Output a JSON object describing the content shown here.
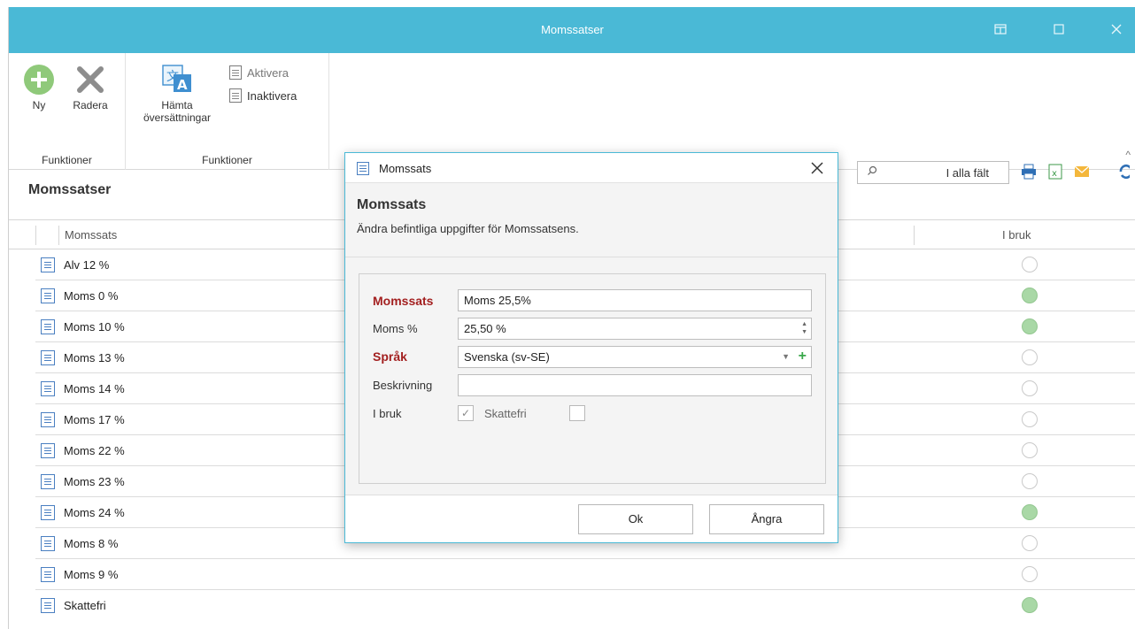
{
  "window": {
    "title": "Momssatser"
  },
  "ribbon": {
    "groups": [
      {
        "label": "Funktioner"
      },
      {
        "label": "Funktioner"
      }
    ],
    "new_label": "Ny",
    "delete_label": "Radera",
    "fetch_translations_label_1": "Hämta",
    "fetch_translations_label_2": "översättningar",
    "activate_label": "Aktivera",
    "deactivate_label": "Inaktivera"
  },
  "list": {
    "title": "Momssatser",
    "search_scope": "I alla fält",
    "columns": {
      "name": "Momssats",
      "in_use": "I bruk"
    },
    "rows": [
      {
        "label": "Alv 12 %",
        "in_use": false
      },
      {
        "label": "Moms 0 %",
        "in_use": true
      },
      {
        "label": "Moms 10 %",
        "in_use": true
      },
      {
        "label": "Moms 13 %",
        "in_use": false
      },
      {
        "label": "Moms 14 %",
        "in_use": false
      },
      {
        "label": "Moms 17 %",
        "in_use": false
      },
      {
        "label": "Moms 22 %",
        "in_use": false
      },
      {
        "label": "Moms 23 %",
        "in_use": false
      },
      {
        "label": "Moms 24 %",
        "in_use": true
      },
      {
        "label": "Moms 8 %",
        "in_use": false
      },
      {
        "label": "Moms 9 %",
        "in_use": false
      },
      {
        "label": "Skattefri",
        "in_use": true
      }
    ]
  },
  "dialog": {
    "title": "Momssats",
    "heading": "Momssats",
    "description": "Ändra befintliga uppgifter för Momssatsens.",
    "fields": {
      "name_label": "Momssats",
      "name_value": "Moms 25,5%",
      "percent_label": "Moms %",
      "percent_value": "25,50 %",
      "language_label": "Språk",
      "language_value": "Svenska (sv-SE)",
      "description_label": "Beskrivning",
      "description_value": "",
      "in_use_label": "I bruk",
      "tax_free_label": "Skattefri"
    },
    "ok_label": "Ok",
    "cancel_label": "Ångra"
  },
  "colors": {
    "accent": "#4ab9d6",
    "required_label": "#a32020",
    "in_use_on": "#a9d8a6",
    "add_green": "#3aa84a"
  }
}
